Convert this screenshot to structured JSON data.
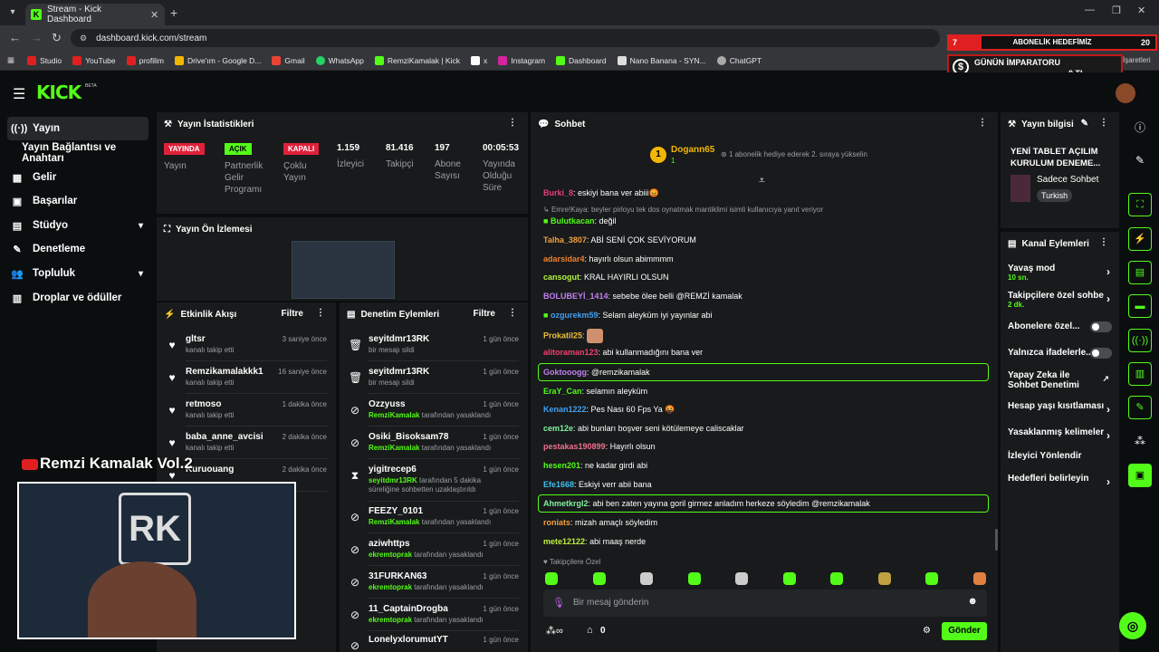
{
  "browser": {
    "tab_title": "Stream - Kick Dashboard",
    "url": "dashboard.kick.com/stream",
    "bookmarks": [
      "Studio",
      "YouTube",
      "profilim",
      "Drive'ım - Google D...",
      "Gmail",
      "WhatsApp",
      "RemziKamalak | Kick",
      "x",
      "Instagram",
      "Dashboard",
      "Nano Banana - SYN...",
      "ChatGPT"
    ]
  },
  "overlay": {
    "sub_goal_count": "7",
    "sub_goal_label": "ABONELİK HEDEFİMİZ",
    "sub_goal_target": "20",
    "emperor_title": "GÜNÜN İMPARATORU",
    "emperor_name": "-",
    "emperor_amount": "0 TL",
    "bookmarks_tail": "İşaretleri",
    "cam_title": "Remzi Kamalak Vol.2"
  },
  "header": {
    "logo": "KICK",
    "beta": "BETA"
  },
  "sidebar": {
    "items": [
      {
        "label": "Yayın"
      },
      {
        "label": "Yayın Bağlantısı ve Anahtarı"
      },
      {
        "label": "Gelir"
      },
      {
        "label": "Başarılar"
      },
      {
        "label": "Stüdyo"
      },
      {
        "label": "Denetleme"
      },
      {
        "label": "Topluluk"
      },
      {
        "label": "Droplar ve ödüller"
      }
    ]
  },
  "stats": {
    "title": "Yayın İstatistikleri",
    "live_badge": "YAYINDA",
    "live_label": "Yayın",
    "partner_badge": "AÇIK",
    "partner_label": "Partnerlik Gelir Programı",
    "multi_badge": "KAPALI",
    "multi_label": "Çoklu Yayın",
    "viewers": "1.159",
    "viewers_label": "İzleyici",
    "followers": "81.416",
    "followers_label": "Takipçi",
    "subs": "197",
    "subs_label": "Abone Sayısı",
    "uptime": "00:05:53",
    "uptime_label": "Yayında Olduğu Süre"
  },
  "preview": {
    "title": "Yayın Ön İzlemesi"
  },
  "activity": {
    "title": "Etkinlik Akışı",
    "filter": "Filtre",
    "rows": [
      {
        "name": "gltsr",
        "sub": "kanalı takip etti",
        "time": "3 saniye önce"
      },
      {
        "name": "Remzikamalakkk1",
        "sub": "kanalı takip etti",
        "time": "16 saniye önce"
      },
      {
        "name": "retmoso",
        "sub": "kanalı takip etti",
        "time": "1 dakika önce"
      },
      {
        "name": "baba_anne_avcisi",
        "sub": "kanalı takip etti",
        "time": "2 dakika önce"
      },
      {
        "name": "Kuruouang",
        "sub": "",
        "time": "2 dakika önce"
      }
    ]
  },
  "moderation": {
    "title": "Denetim Eylemleri",
    "filter": "Filtre",
    "rows": [
      {
        "name": "seyitdmr13RK",
        "by": "",
        "sub": "bir mesajı sildi",
        "time": "1 gün önce"
      },
      {
        "name": "seyitdmr13RK",
        "by": "",
        "sub": "bir mesajı sildi",
        "time": "1 gün önce"
      },
      {
        "name": "Ozzyuss",
        "by": "RemziKamalak",
        "sub": "tarafından yasaklandı",
        "time": "1 gün önce"
      },
      {
        "name": "Osiki_Bisoksam78",
        "by": "RemziKamalak",
        "sub": "tarafından yasaklandı",
        "time": "1 gün önce"
      },
      {
        "name": "yigitrecep6",
        "by": "seyitdmr13RK",
        "sub": "tarafından 5 dakika süreliğine sohbetten uzaklaştırıldı",
        "time": "1 gün önce"
      },
      {
        "name": "FEEZY_0101",
        "by": "RemziKamalak",
        "sub": "tarafından yasaklandı",
        "time": "1 gün önce"
      },
      {
        "name": "aziwhttps",
        "by": "ekremtoprak",
        "sub": "tarafından yasaklandı",
        "time": "1 gün önce"
      },
      {
        "name": "31FURKAN63",
        "by": "ekremtoprak",
        "sub": "tarafından yasaklandı",
        "time": "1 gün önce"
      },
      {
        "name": "11_CaptainDrogba",
        "by": "ekremtoprak",
        "sub": "tarafından yasaklandı",
        "time": "1 gün önce"
      },
      {
        "name": "LonelyxlorumutYT",
        "by": "",
        "sub": "",
        "time": "1 gün önce"
      }
    ]
  },
  "chat": {
    "title": "Sohbet",
    "pinned_user": "Dogann65",
    "pinned_rank": "1",
    "pinned_count": "1",
    "pinned_text": "1 abonelik hediye ederek 2. sıraya yükselin",
    "reply_hint": "Emre!Kaya: beyler pirloyu tek dos oynatmak mantiklimi isimli kullanıcıya yanıt veriyor",
    "messages": [
      {
        "user": "Burki_8",
        "color": "#e0407a",
        "text": "eskiyi bana ver abiii😡"
      },
      {
        "user": "Bulutkacan",
        "color": "#53fc18",
        "text": "değil"
      },
      {
        "user": "Talha_3807",
        "color": "#f0a040",
        "text": "ABİ SENİ ÇOK SEVİYORUM"
      },
      {
        "user": "adarsidar4",
        "color": "#f08030",
        "text": "hayırlı olsun abimmmm"
      },
      {
        "user": "cansogut",
        "color": "#b0f040",
        "text": "KRAL HAYIRLI OLSUN"
      },
      {
        "user": "BOLUBEYİ_1414",
        "color": "#c080f0",
        "text": "sebebe ölee belli @REMZİ kamalak"
      },
      {
        "user": "ozgurekm59",
        "color": "#40a0f0",
        "text": "Selam aleyküm iyi yayınlar abi"
      },
      {
        "user": "Prokatil25",
        "color": "#f0c040",
        "text": ""
      },
      {
        "user": "alitoraman123",
        "color": "#f04070",
        "text": "abi kullanmadığını bana ver"
      },
      {
        "user": "Goktooogg",
        "color": "#c080f0",
        "text": "@remzikamalak"
      },
      {
        "user": "EraY_Can",
        "color": "#53fc18",
        "text": "selamın aleyküm"
      },
      {
        "user": "Kenan1222",
        "color": "#40a0f0",
        "text": "Pes Nası 60 Fps Ya 🤬"
      },
      {
        "user": "cem12e",
        "color": "#80f0a0",
        "text": "abi bunları boşver seni kötülemeye caliscaklar"
      },
      {
        "user": "pestakas190899",
        "color": "#f07090",
        "text": "Hayırlı olsun"
      },
      {
        "user": "hesen201",
        "color": "#53fc18",
        "text": "ne kadar girdi abi"
      },
      {
        "user": "Efe1668",
        "color": "#40c0f0",
        "text": "Eskiyi verr abii bana"
      },
      {
        "user": "Ahmetkrgl2",
        "color": "#80f0a0",
        "text": "abi ben zaten yayına goril girmez anladım herkeze söyledim @remzikamalak"
      },
      {
        "user": "roniats",
        "color": "#f0a040",
        "text": "mizah amaçlı söyledim"
      },
      {
        "user": "mete12122",
        "color": "#c0f040",
        "text": "abi maaş nerde"
      }
    ],
    "followers_only": "Takipçilere Özel",
    "input_placeholder": "Bir mesaj gönderin",
    "count": "0",
    "send": "Gönder"
  },
  "stream_info": {
    "title": "Yayın bilgisi",
    "stream_title": "YENİ TABLET AÇILIM KURULUM DENEME...",
    "category": "Sadece Sohbet",
    "language": "Turkish"
  },
  "channel_actions": {
    "title": "Kanal Eylemleri",
    "slow_mode": "Yavaş mod",
    "slow_mode_val": "10 sn.",
    "followers_chat": "Takipçilere özel sohbe",
    "followers_chat_val": "2 dk.",
    "subs_only": "Abonelere özel...",
    "emotes_only": "Yalnızca ifadelerle...",
    "ai_mod": "Yapay Zeka ile Sohbet Denetimi",
    "age_limits": "Hesap yaşı kısıtlaması",
    "banned_words": "Yasaklanmış kelimeler",
    "redirect": "İzleyici Yönlendir",
    "goals": "Hedefleri belirleyin"
  }
}
